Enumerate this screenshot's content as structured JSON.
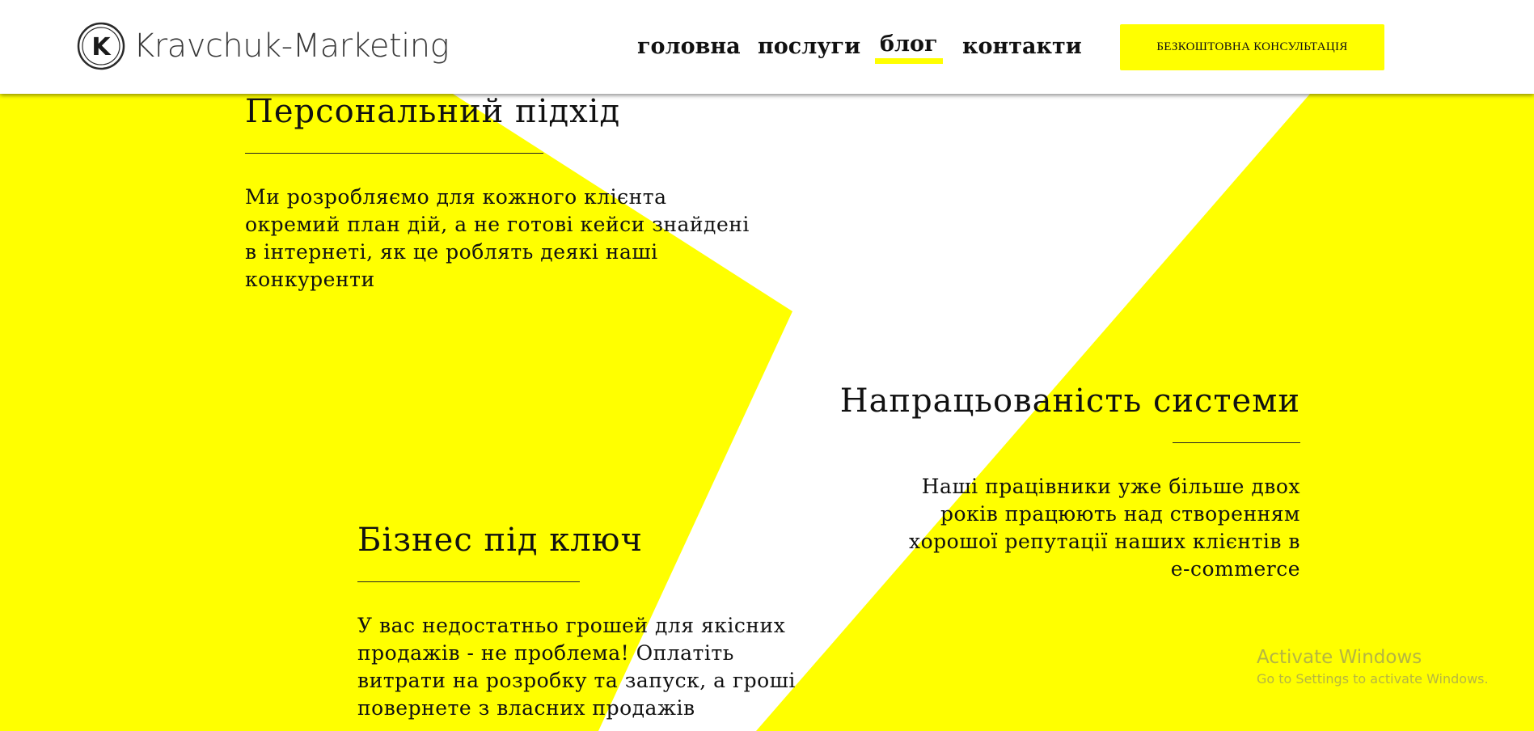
{
  "brand": {
    "logo_letter": "K",
    "name": "Kravchuk-Marketing"
  },
  "nav": {
    "items": [
      {
        "label": "головна",
        "active": false
      },
      {
        "label": "послуги",
        "active": false
      },
      {
        "label": "блог",
        "active": true
      },
      {
        "label": "контакти",
        "active": false
      }
    ],
    "cta_label": "БЕЗКОШТОВНА КОНСУЛЬТАЦІЯ"
  },
  "features": [
    {
      "title": "Персональний підхід",
      "lines": [
        "Ми розробляємо для кожного клієнта",
        "окремий план дій, а не готові кейси знайдені",
        "в інтернеті, як це роблять деякі наші",
        "конкуренти"
      ]
    },
    {
      "title": "Напрацьованість системи",
      "lines": [
        "Наші працівники уже більше двох",
        "років працюють над створенням",
        "хорошої репутації наших клієнтів в",
        "e-commerce"
      ]
    },
    {
      "title": "Бізнес під ключ",
      "lines": [
        "У вас недостатньо грошей для якісних",
        "продажів - не проблема! Оплатіть",
        "витрати на розробку та запуск, а гроші",
        "повернете з власних продажів"
      ]
    }
  ],
  "os_watermark": {
    "title": "Activate Windows",
    "subtitle": "Go to Settings to activate Windows."
  },
  "colors": {
    "accent": "#ffff00",
    "text": "#111111",
    "background": "#ffffff"
  }
}
